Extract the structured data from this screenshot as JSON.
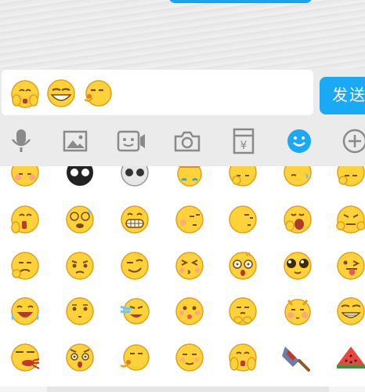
{
  "send_label": "发送",
  "colors": {
    "accent": "#1aa9f5",
    "emoji_face": "#ffd23a",
    "emoji_outline": "#e0a11a",
    "toolbar_bg": "#ebebeb",
    "icon_gray": "#8a8a8a"
  },
  "input_emojis": [
    "covering-face",
    "grinning-squint",
    "kiss-side"
  ],
  "toolbar": [
    {
      "name": "voice-icon"
    },
    {
      "name": "image-icon"
    },
    {
      "name": "video-call-icon"
    },
    {
      "name": "camera-icon"
    },
    {
      "name": "red-packet-icon"
    },
    {
      "name": "emoji-icon",
      "active": true
    },
    {
      "name": "plus-icon"
    }
  ],
  "emoji_rows": [
    [
      "shy",
      "skull-dark",
      "skull",
      "hammered",
      "thinking",
      "sweat",
      "angry"
    ],
    [
      "bloody",
      "dizzy",
      "grin-teeth",
      "sideeye",
      "sulk",
      "yawn",
      "strong"
    ],
    [
      "sad-hand",
      "worried",
      "smirk",
      "squint-kiss",
      "shocked",
      "teary-eyes",
      "tongue-wink"
    ],
    [
      "laugh-cry",
      "blank",
      "crying",
      "shy-smile",
      "pout",
      "rosy",
      "grin-glasses"
    ],
    [
      "blood-spit",
      "speechless",
      "shh",
      "meh",
      "covering-face",
      "cleaver",
      "watermelon"
    ]
  ]
}
